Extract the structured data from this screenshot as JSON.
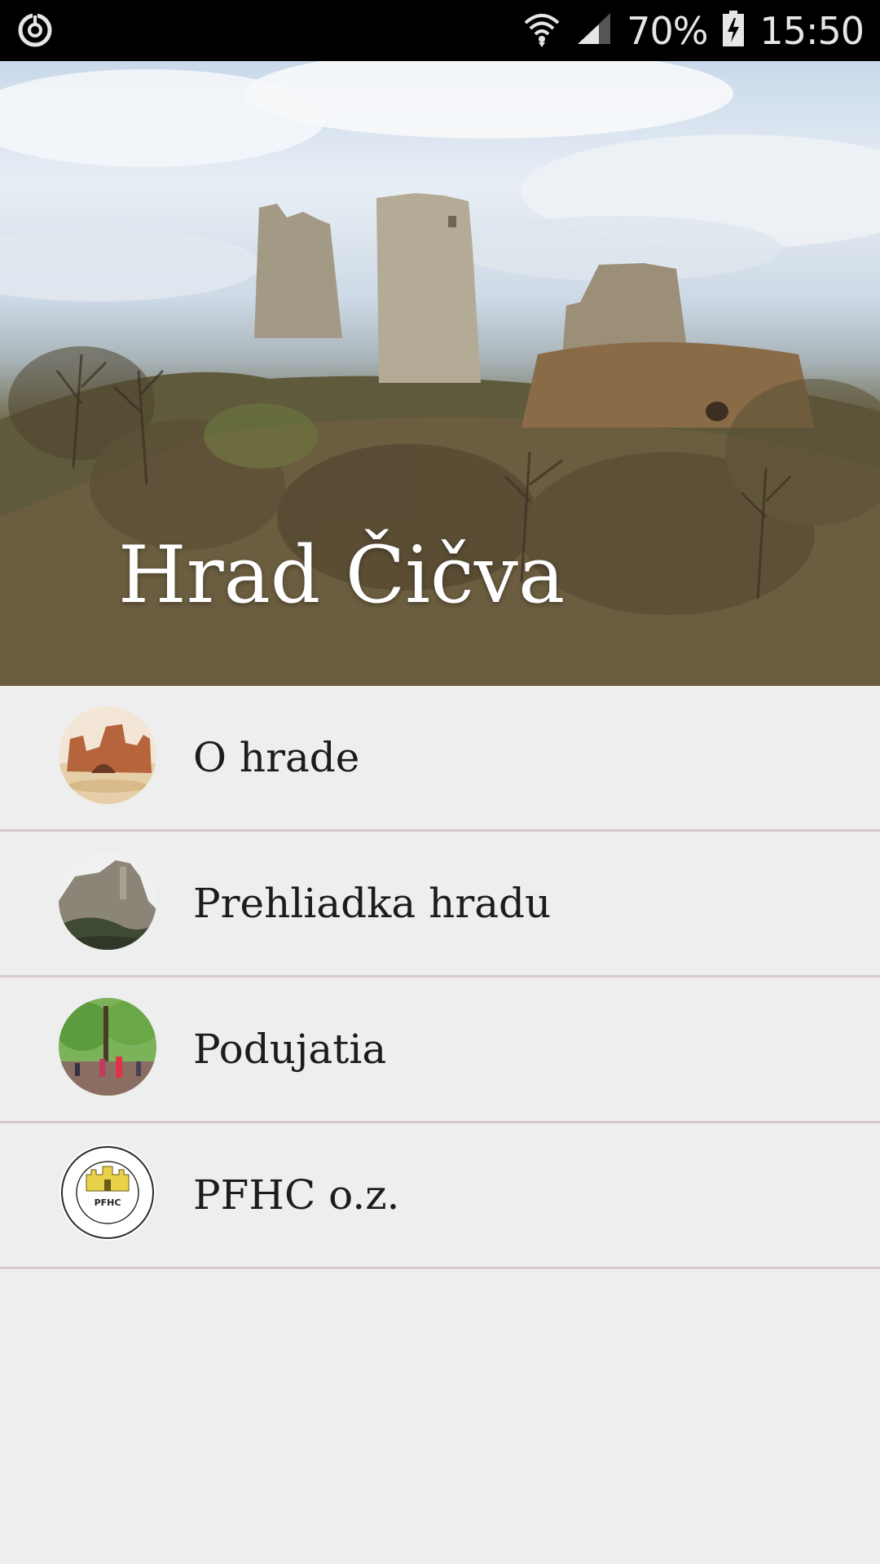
{
  "status_bar": {
    "battery": "70%",
    "time": "15:50"
  },
  "header": {
    "title": "Hrad Čičva"
  },
  "menu": {
    "items": [
      {
        "label": "O hrade"
      },
      {
        "label": "Prehliadka hradu"
      },
      {
        "label": "Podujatia"
      },
      {
        "label": "PFHC o.z."
      }
    ]
  },
  "logo": {
    "ring_text": "Pro futuro hradu Čičva",
    "center_text": "PFHC",
    "bottom_text": "občianske združenie"
  }
}
